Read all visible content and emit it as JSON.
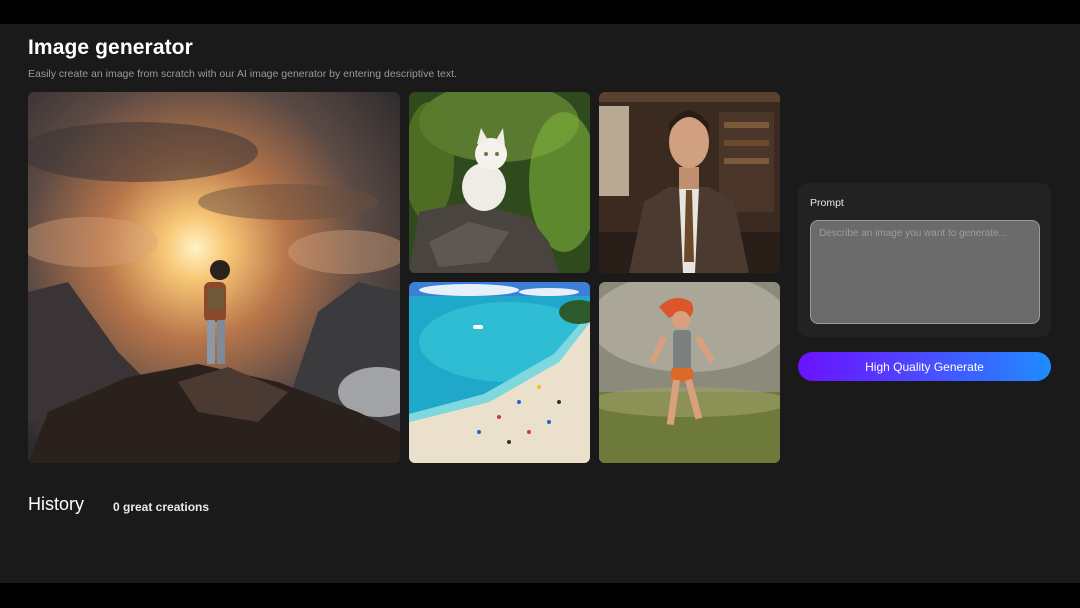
{
  "header": {
    "title": "Image generator",
    "subtitle": "Easily create an image from scratch with our AI image generator by entering descriptive text."
  },
  "gallery": {
    "images": [
      {
        "name": "boy-on-mountain-sunset-image"
      },
      {
        "name": "white-cat-in-foliage-image"
      },
      {
        "name": "man-in-suit-library-image"
      },
      {
        "name": "tropical-beach-aerial-image"
      },
      {
        "name": "red-haired-runner-image"
      }
    ]
  },
  "prompt": {
    "label": "Prompt",
    "placeholder": "Describe an image you want to generate..."
  },
  "generate_button": {
    "label": "High Quality Generate",
    "gradient": [
      "#6a12ff",
      "#1f8cff"
    ]
  },
  "history": {
    "title": "History",
    "count_text": "0 great creations"
  },
  "colors": {
    "background": "#1a1a1a",
    "card": "#222222",
    "input": "#6b6b6b"
  }
}
